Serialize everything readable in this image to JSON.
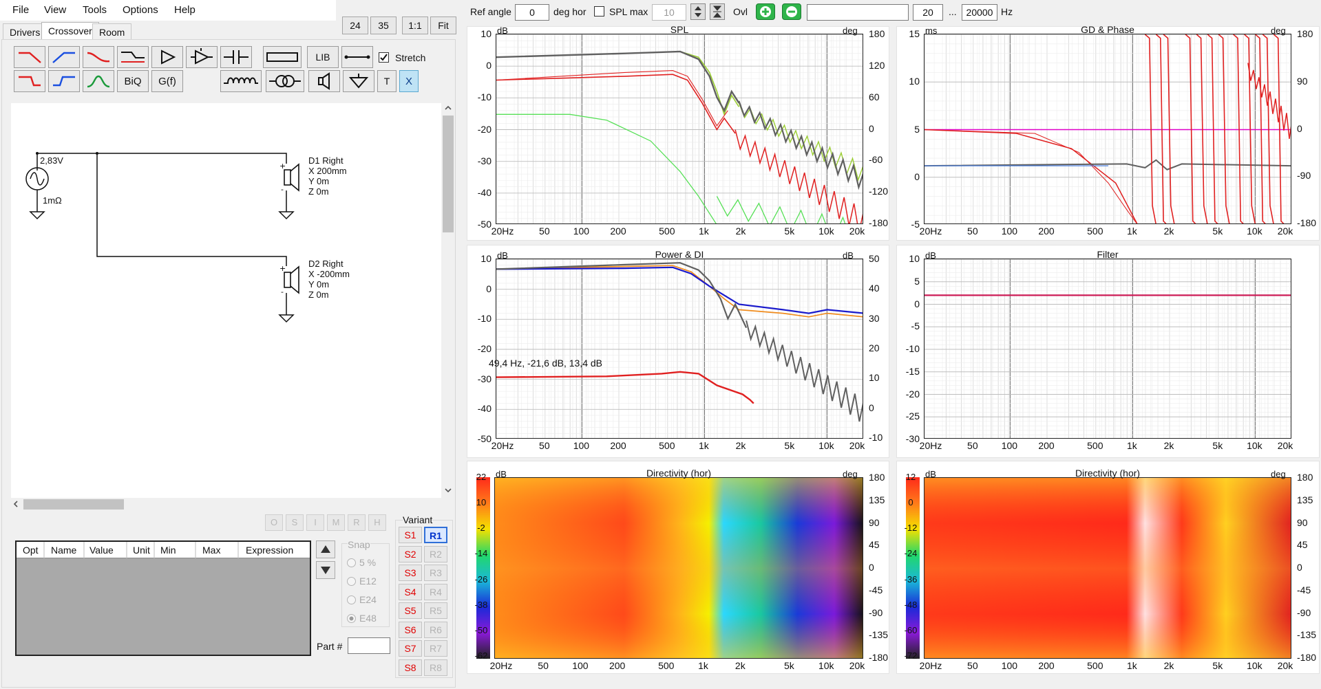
{
  "menu": [
    "File",
    "View",
    "Tools",
    "Options",
    "Help"
  ],
  "tabs": {
    "drivers": "Drivers",
    "crossover": "Crossover",
    "room": "Room"
  },
  "zoom": {
    "a": "24",
    "b": "35",
    "c": "1:1",
    "d": "Fit"
  },
  "tools": {
    "lib": "LIB",
    "stretch": "Stretch",
    "biq": "BiQ",
    "gf": "G(f)",
    "t": "T",
    "x": "X"
  },
  "schematic": {
    "source_voltage": "2,83V",
    "source_res": "1mΩ",
    "d1": "D1 Right\nX 200mm\nY 0m\nZ 0m",
    "d2": "D2 Right\nX -200mm\nY 0m\nZ 0m"
  },
  "opt_buttons": [
    "O",
    "S",
    "I",
    "M",
    "R",
    "H"
  ],
  "opt_headers": [
    "Opt",
    "Name",
    "Value",
    "Unit",
    "Min",
    "Max",
    "Expression"
  ],
  "snap": {
    "label": "Snap",
    "options": [
      "5 %",
      "E12",
      "E24",
      "E48"
    ],
    "selected": "E48"
  },
  "part": {
    "label": "Part #"
  },
  "variant": {
    "label": "Variant",
    "s": [
      "S1",
      "S2",
      "S3",
      "S4",
      "S5",
      "S6",
      "S7",
      "S8"
    ],
    "r": [
      "R1",
      "R2",
      "R3",
      "R4",
      "R5",
      "R6",
      "R7",
      "R8"
    ],
    "selected": "R1"
  },
  "topbar": {
    "ref_angle_label": "Ref angle",
    "ref_angle": "0",
    "deg_hor": "deg hor",
    "spl_max_label": "SPL max",
    "spl_max": "10",
    "ovl": "Ovl",
    "freq_from": "20",
    "ellipsis": "...",
    "freq_to": "20000",
    "hz": "Hz"
  },
  "xticks": [
    "20Hz",
    "50",
    "100",
    "200",
    "500",
    "1k",
    "2k",
    "5k",
    "10k",
    "20k"
  ],
  "plots": {
    "spl": {
      "title": "SPL",
      "left_unit": "dB",
      "right_unit": "deg",
      "left": [
        "10",
        "0",
        "-10",
        "-20",
        "-30",
        "-40",
        "-50"
      ],
      "right": [
        "180",
        "120",
        "60",
        "0",
        "-60",
        "-120",
        "-180"
      ]
    },
    "gd": {
      "title": "GD & Phase",
      "left_unit": "ms",
      "right_unit": "deg",
      "left": [
        "15",
        "10",
        "5",
        "0",
        "-5"
      ],
      "right": [
        "180",
        "90",
        "0",
        "-90",
        "-180"
      ]
    },
    "power": {
      "title": "Power & DI",
      "left_unit": "dB",
      "right_unit": "dB",
      "left": [
        "10",
        "0",
        "-10",
        "-20",
        "-30",
        "-40",
        "-50"
      ],
      "right": [
        "50",
        "40",
        "30",
        "20",
        "10",
        "0",
        "-10"
      ],
      "note": "49,4 Hz, -21,6 dB, 13,4 dB"
    },
    "filter": {
      "title": "Filter",
      "left_unit": "dB",
      "left": [
        "10",
        "5",
        "0",
        "-5",
        "-10",
        "-15",
        "-20",
        "-25",
        "-30"
      ]
    },
    "dir1": {
      "title": "Directivity (hor)",
      "left_unit": "dB",
      "right_unit": "deg",
      "scale": [
        "22",
        "10",
        "-2",
        "-14",
        "-26",
        "-38",
        "-50",
        "-62"
      ],
      "right": [
        "180",
        "135",
        "90",
        "45",
        "0",
        "-45",
        "-90",
        "-135",
        "-180"
      ]
    },
    "dir2": {
      "title": "Directivity (hor)",
      "left_unit": "dB",
      "right_unit": "deg",
      "scale": [
        "12",
        "0",
        "-12",
        "-24",
        "-36",
        "-48",
        "-60",
        "-72"
      ],
      "right": [
        "180",
        "135",
        "90",
        "45",
        "0",
        "-45",
        "-90",
        "-135",
        "-180"
      ]
    }
  },
  "colors": {
    "red": "#e02020",
    "green": "#44d844",
    "olive": "#9acd32",
    "gray": "#606060",
    "blue": "#1a1acc",
    "orange": "#f08c1e",
    "magenta": "#e000c8"
  }
}
